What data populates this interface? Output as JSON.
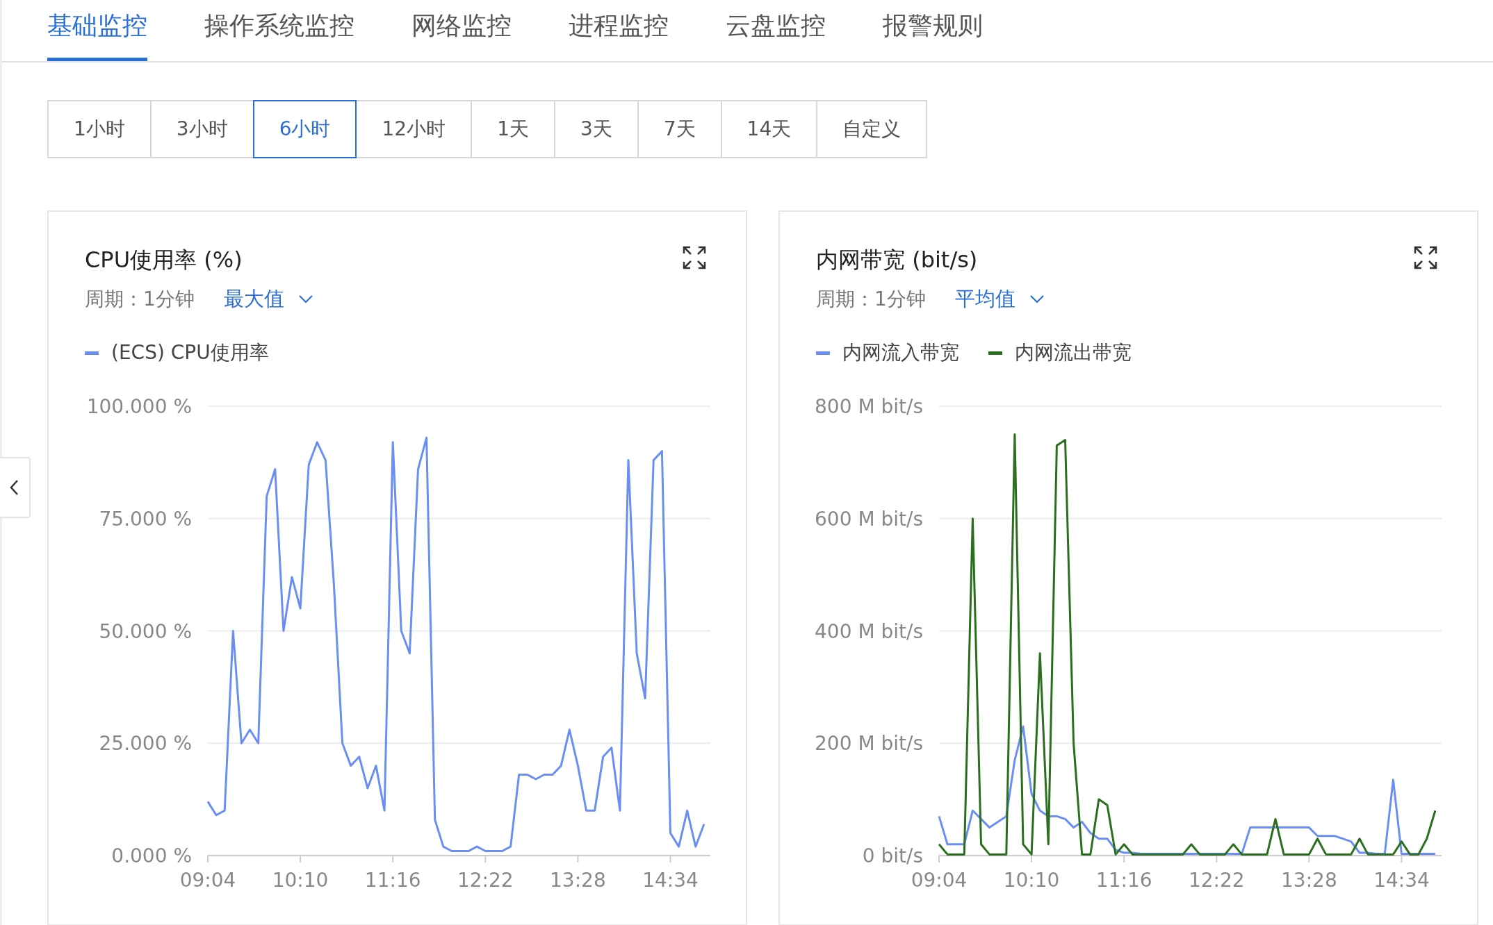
{
  "tabs": [
    {
      "label": "基础监控",
      "selected": true
    },
    {
      "label": "操作系统监控",
      "selected": false
    },
    {
      "label": "网络监控",
      "selected": false
    },
    {
      "label": "进程监控",
      "selected": false
    },
    {
      "label": "云盘监控",
      "selected": false
    },
    {
      "label": "报警规则",
      "selected": false
    }
  ],
  "time_ranges": [
    {
      "label": "1小时",
      "selected": false
    },
    {
      "label": "3小时",
      "selected": false
    },
    {
      "label": "6小时",
      "selected": true
    },
    {
      "label": "12小时",
      "selected": false
    },
    {
      "label": "1天",
      "selected": false
    },
    {
      "label": "3天",
      "selected": false
    },
    {
      "label": "7天",
      "selected": false
    },
    {
      "label": "14天",
      "selected": false
    },
    {
      "label": "自定义",
      "selected": false
    }
  ],
  "panels": [
    {
      "title": "CPU使用率 (%)",
      "period": "周期：1分钟",
      "aggregation": "最大值",
      "chart_data": {
        "type": "line",
        "categories": [
          "09:04",
          null,
          null,
          null,
          null,
          null,
          null,
          null,
          null,
          null,
          null,
          "10:10",
          null,
          null,
          null,
          null,
          null,
          null,
          null,
          null,
          null,
          null,
          "11:16",
          null,
          null,
          null,
          null,
          null,
          null,
          null,
          null,
          null,
          null,
          "12:22",
          null,
          null,
          null,
          null,
          null,
          null,
          null,
          null,
          null,
          null,
          "13:28",
          null,
          null,
          null,
          null,
          null,
          null,
          null,
          null,
          null,
          null,
          "14:34",
          null,
          null,
          null,
          null
        ],
        "ylim": [
          0,
          100
        ],
        "grid": true,
        "yticks": [
          {
            "value": 0,
            "label": "0.000 %"
          },
          {
            "value": 25,
            "label": "25.000 %"
          },
          {
            "value": 50,
            "label": "50.000 %"
          },
          {
            "value": 75,
            "label": "75.000 %"
          },
          {
            "value": 100,
            "label": "100.000 %"
          }
        ],
        "series": [
          {
            "name": "(ECS) CPU使用率",
            "color": "#6a8ef2",
            "values": [
              12,
              9,
              10,
              50,
              25,
              28,
              25,
              80,
              86,
              50,
              62,
              55,
              87,
              92,
              88,
              60,
              25,
              20,
              22,
              15,
              20,
              10,
              92,
              50,
              45,
              86,
              93,
              8,
              2,
              1,
              1,
              1,
              2,
              1,
              1,
              1,
              2,
              18,
              18,
              17,
              18,
              18,
              20,
              28,
              20,
              10,
              10,
              22,
              24,
              10,
              88,
              45,
              35,
              88,
              90,
              5,
              2,
              10,
              2,
              7
            ]
          }
        ]
      }
    },
    {
      "title": "内网带宽 (bit/s)",
      "period": "周期：1分钟",
      "aggregation": "平均值",
      "chart_data": {
        "type": "line",
        "categories": [
          "09:04",
          null,
          null,
          null,
          null,
          null,
          null,
          null,
          null,
          null,
          null,
          "10:10",
          null,
          null,
          null,
          null,
          null,
          null,
          null,
          null,
          null,
          null,
          "11:16",
          null,
          null,
          null,
          null,
          null,
          null,
          null,
          null,
          null,
          null,
          "12:22",
          null,
          null,
          null,
          null,
          null,
          null,
          null,
          null,
          null,
          null,
          "13:28",
          null,
          null,
          null,
          null,
          null,
          null,
          null,
          null,
          null,
          null,
          "14:34",
          null,
          null,
          null,
          null
        ],
        "ylim": [
          0,
          800
        ],
        "grid": true,
        "yticks": [
          {
            "value": 0,
            "label": "0  bit/s"
          },
          {
            "value": 200,
            "label": "200 M bit/s"
          },
          {
            "value": 400,
            "label": "400 M bit/s"
          },
          {
            "value": 600,
            "label": "600 M bit/s"
          },
          {
            "value": 800,
            "label": "800 M bit/s"
          }
        ],
        "series": [
          {
            "name": "内网流入带宽",
            "color": "#6a8ef2",
            "values": [
              70,
              20,
              20,
              20,
              80,
              65,
              50,
              60,
              70,
              170,
              230,
              110,
              80,
              70,
              70,
              65,
              50,
              60,
              40,
              30,
              30,
              10,
              5,
              5,
              3,
              3,
              3,
              3,
              3,
              3,
              3,
              3,
              3,
              3,
              3,
              3,
              3,
              50,
              50,
              50,
              50,
              50,
              50,
              50,
              50,
              35,
              35,
              35,
              30,
              25,
              5,
              5,
              3,
              3,
              135,
              3,
              3,
              3,
              3,
              3
            ]
          },
          {
            "name": "内网流出带宽",
            "color": "#2a6e1e",
            "values": [
              20,
              2,
              2,
              2,
              600,
              20,
              2,
              2,
              2,
              750,
              20,
              2,
              360,
              20,
              730,
              740,
              200,
              2,
              2,
              100,
              90,
              2,
              20,
              2,
              2,
              2,
              2,
              2,
              2,
              2,
              20,
              2,
              2,
              2,
              2,
              20,
              2,
              2,
              2,
              2,
              65,
              2,
              2,
              2,
              2,
              30,
              2,
              2,
              2,
              2,
              30,
              2,
              2,
              2,
              2,
              25,
              2,
              2,
              30,
              80
            ]
          }
        ]
      }
    }
  ]
}
